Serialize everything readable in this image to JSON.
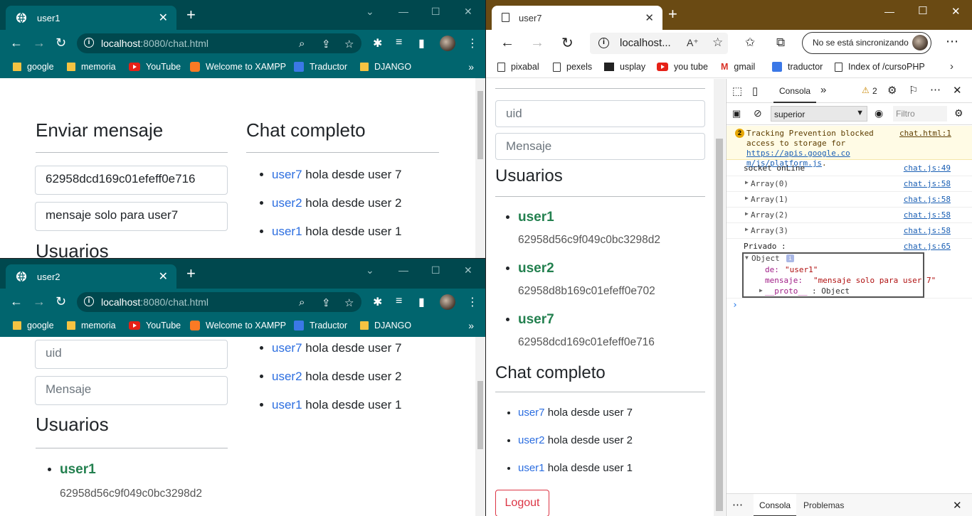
{
  "user1_window": {
    "tab_title": "user1",
    "url_host": "localhost",
    "url_rest": ":8080/chat.html",
    "bookmarks": [
      "google",
      "memoria",
      "YouTube",
      "Welcome to XAMPP",
      "Traductor",
      "DJANGO"
    ],
    "heading_send": "Enviar mensaje",
    "heading_chat": "Chat completo",
    "uid_value": "62958dcd169c01efeff0e716",
    "message_value": "mensaje solo para user7",
    "heading_users_partial": "Usuarios",
    "chat": [
      {
        "user": "user7",
        "text": "hola desde user 7"
      },
      {
        "user": "user2",
        "text": "hola desde user 2"
      },
      {
        "user": "user1",
        "text": "hola desde user 1"
      }
    ]
  },
  "user2_window": {
    "tab_title": "user2",
    "url_host": "localhost",
    "url_rest": ":8080/chat.html",
    "bookmarks": [
      "google",
      "memoria",
      "YouTube",
      "Welcome to XAMPP",
      "Traductor",
      "DJANGO"
    ],
    "uid_placeholder": "uid",
    "message_placeholder": "Mensaje",
    "heading_users": "Usuarios",
    "users": [
      {
        "name": "user1",
        "id": "62958d56c9f049c0bc3298d2"
      }
    ],
    "chat": [
      {
        "user": "user7",
        "text": "hola desde user 7"
      },
      {
        "user": "user2",
        "text": "hola desde user 2"
      },
      {
        "user": "user1",
        "text": "hola desde user 1"
      }
    ]
  },
  "user7_window": {
    "tab_title": "user7",
    "url": "localhost...",
    "sync_label": "No se está sincronizando",
    "bookmarks": [
      "pixabal",
      "pexels",
      "usplay",
      "you tube",
      "gmail",
      "traductor",
      "Index of /cursoPHP"
    ],
    "uid_placeholder": "uid",
    "message_placeholder": "Mensaje",
    "heading_users": "Usuarios",
    "users": [
      {
        "name": "user1",
        "id": "62958d56c9f049c0bc3298d2"
      },
      {
        "name": "user2",
        "id": "62958d8b169c01efeff0e702"
      },
      {
        "name": "user7",
        "id": "62958dcd169c01efeff0e716"
      }
    ],
    "heading_chat": "Chat completo",
    "chat": [
      {
        "user": "user7",
        "text": "hola desde user 7"
      },
      {
        "user": "user2",
        "text": "hola desde user 2"
      },
      {
        "user": "user1",
        "text": "hola desde user 1"
      }
    ],
    "logout_label": "Logout"
  },
  "devtools": {
    "tab_console": "Consola",
    "warnings_count": "2",
    "context": "superior",
    "filter_placeholder": "Filtro",
    "warning_text_1": "Tracking Prevention blocked",
    "warning_text_2": "access to storage for ",
    "warning_link": "https://apis.google.com/js/platform.js",
    "warning_link_a": "https://apis.google.co",
    "warning_link_b": "m/js/platform.js",
    "warning_source": "chat.html:1",
    "logs": [
      {
        "text": "socket onLine",
        "source": "chat.js:49",
        "expandable": false
      },
      {
        "text": "Array(0)",
        "source": "chat.js:58",
        "expandable": true
      },
      {
        "text": "Array(1)",
        "source": "chat.js:58",
        "expandable": true
      },
      {
        "text": "Array(2)",
        "source": "chat.js:58",
        "expandable": true
      },
      {
        "text": "Array(3)",
        "source": "chat.js:58",
        "expandable": true
      }
    ],
    "private_label": "Privado :",
    "private_source": "chat.js:65",
    "object_label": "Object",
    "obj_de_key": "de:",
    "obj_de_val": "\"user1\"",
    "obj_msg_key": "mensaje:",
    "obj_msg_val": "\"mensaje solo para user 7\"",
    "obj_proto": "__proto__",
    "obj_proto_val": ": Object",
    "drawer_console": "Consola",
    "drawer_problems": "Problemas"
  }
}
